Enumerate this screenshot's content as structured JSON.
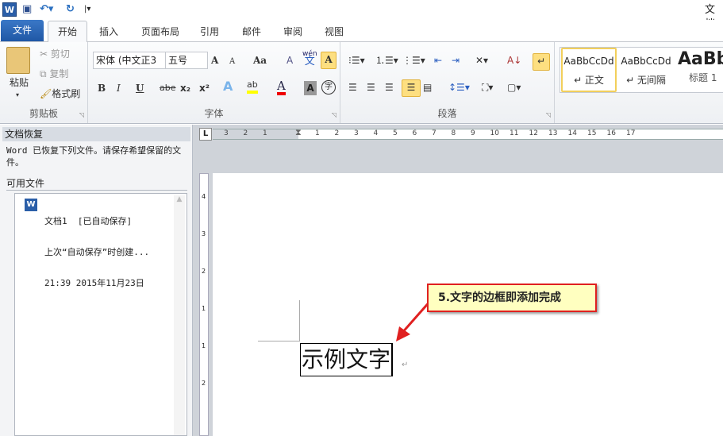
{
  "titlebar": {
    "app_icon": "word-icon",
    "title": "文档",
    "save_icon": "save-icon",
    "undo_icon": "undo-icon",
    "redo_icon": "redo-icon",
    "customize_icon": "customize-arrow-icon"
  },
  "tabs": {
    "file": "文件",
    "items": [
      "开始",
      "插入",
      "页面布局",
      "引用",
      "邮件",
      "审阅",
      "视图"
    ]
  },
  "clipboard": {
    "paste": "粘贴",
    "cut": "剪切",
    "copy": "复制",
    "format_painter": "格式刷",
    "label": "剪贴板"
  },
  "font": {
    "name": "宋体 (中文正3",
    "size": "五号",
    "grow": "A",
    "shrink": "A",
    "case": "Aa",
    "clear": "A",
    "pinyin": "wén",
    "pinyin_char": "文",
    "border_char": "A",
    "bold": "B",
    "italic": "I",
    "underline": "U",
    "strike": "abe",
    "sub": "x₂",
    "sup": "x²",
    "effects": "A",
    "highlight": "ab",
    "color": "A",
    "shading": "A",
    "enclose": "字",
    "label": "字体",
    "highlight_color": "#ffff00",
    "font_color": "#e00000"
  },
  "paragraph": {
    "label": "段落",
    "sort": "A↓"
  },
  "styles": {
    "items": [
      {
        "preview": "AaBbCcDd",
        "name": "↵ 正文"
      },
      {
        "preview": "AaBbCcDd",
        "name": "↵ 无间隔"
      },
      {
        "preview": "AaBb",
        "name": "标题 1"
      }
    ]
  },
  "recovery": {
    "title": "文档恢复",
    "message": "Word 已恢复下列文件。请保存希望保留的文件。",
    "available": "可用文件",
    "file": {
      "name": "文档1  [已自动保存]",
      "desc": "上次“自动保存”时创建...",
      "time": "21:39 2015年11月23日"
    }
  },
  "ruler": {
    "left": [
      "3",
      "2",
      "1"
    ],
    "right": [
      "1",
      "2",
      "3",
      "4",
      "5",
      "6",
      "7",
      "8",
      "9",
      "10",
      "11",
      "12",
      "13",
      "14",
      "15",
      "16",
      "17"
    ],
    "vertical": [
      "4",
      "3",
      "2",
      "1",
      "1",
      "2"
    ]
  },
  "document": {
    "text": "示例文字"
  },
  "callout": {
    "text": "5.文字的边框即添加完成",
    "border_color": "#e02020",
    "bg_color": "#ffffc0"
  }
}
